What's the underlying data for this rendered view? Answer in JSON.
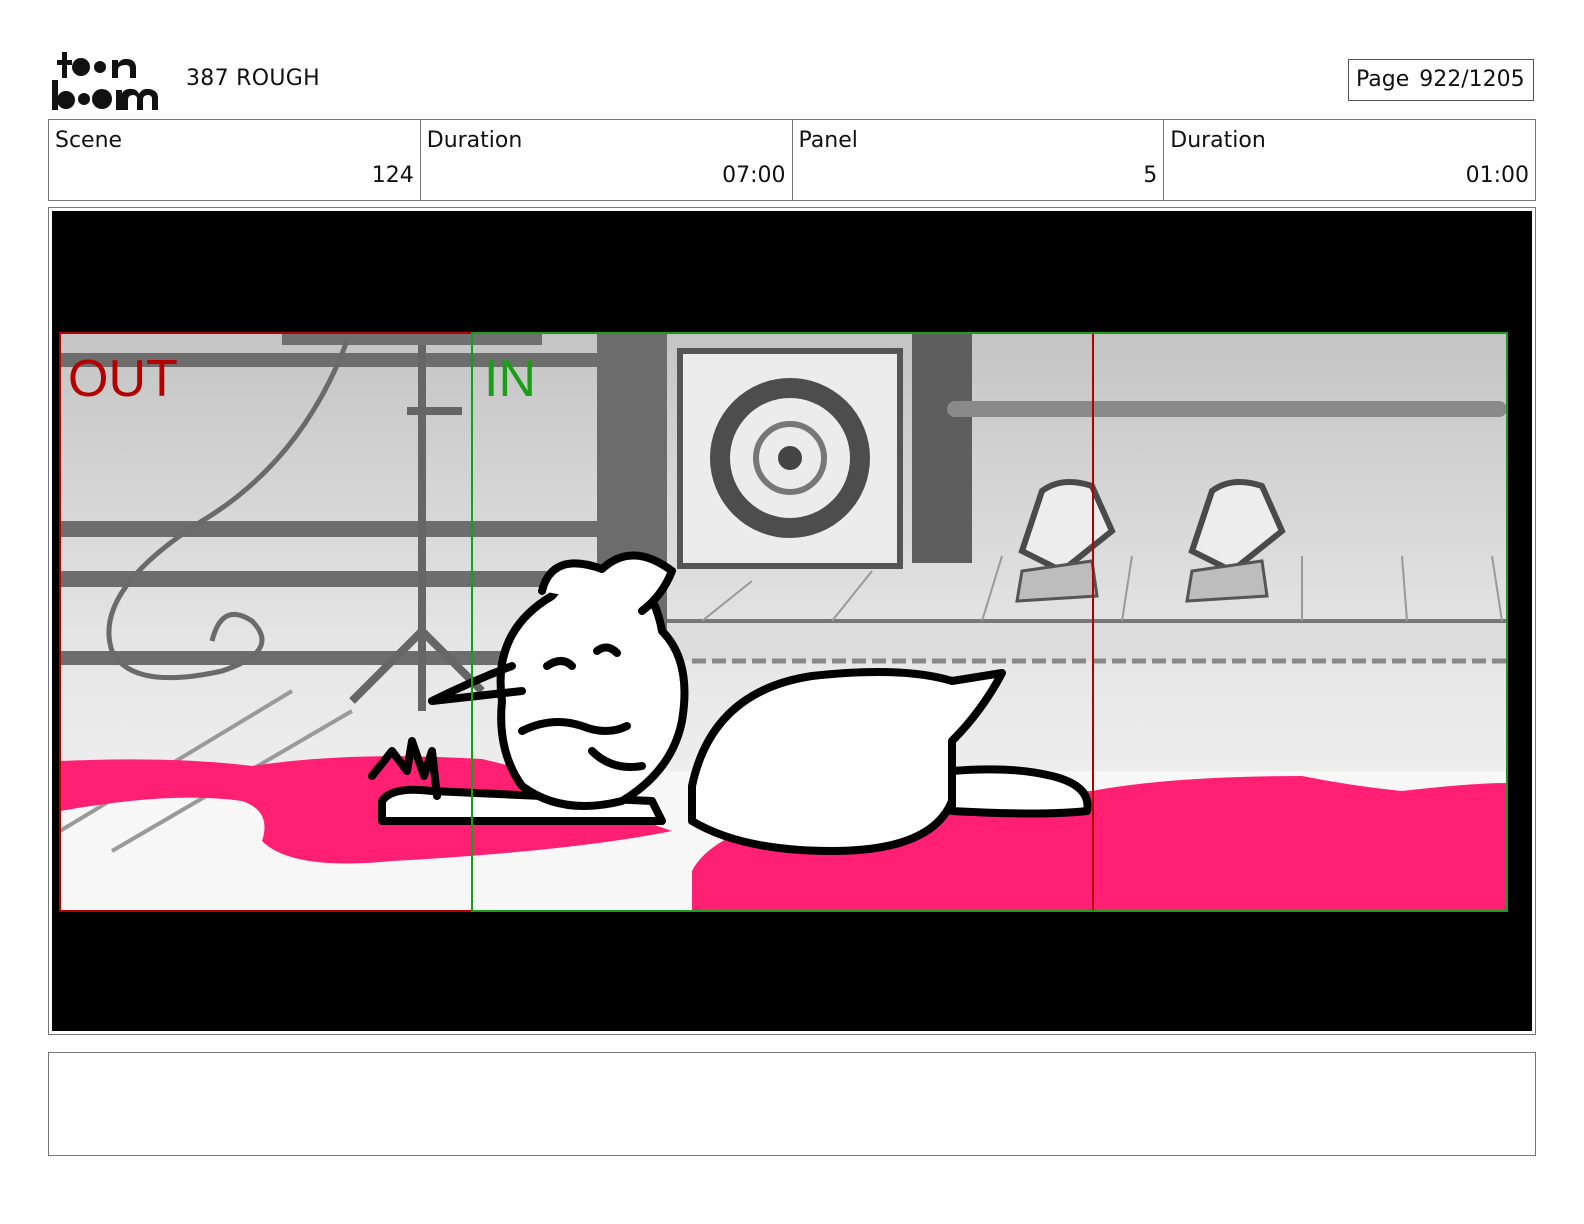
{
  "header": {
    "logo_text": "toon boom",
    "project_title": "387 ROUGH",
    "page_label": "Page",
    "page_number": "922/1205"
  },
  "info": {
    "scene_label": "Scene",
    "scene_value": "124",
    "scene_duration_label": "Duration",
    "scene_duration_value": "07:00",
    "panel_label": "Panel",
    "panel_value": "5",
    "panel_duration_label": "Duration",
    "panel_duration_value": "01:00"
  },
  "panel": {
    "out_marker": "OUT",
    "in_marker": "IN",
    "colors": {
      "out": "#b40000",
      "in": "#1a9e1a",
      "puddle": "#ff1f73",
      "letterbox": "#000000"
    }
  },
  "notes": {
    "text": ""
  }
}
